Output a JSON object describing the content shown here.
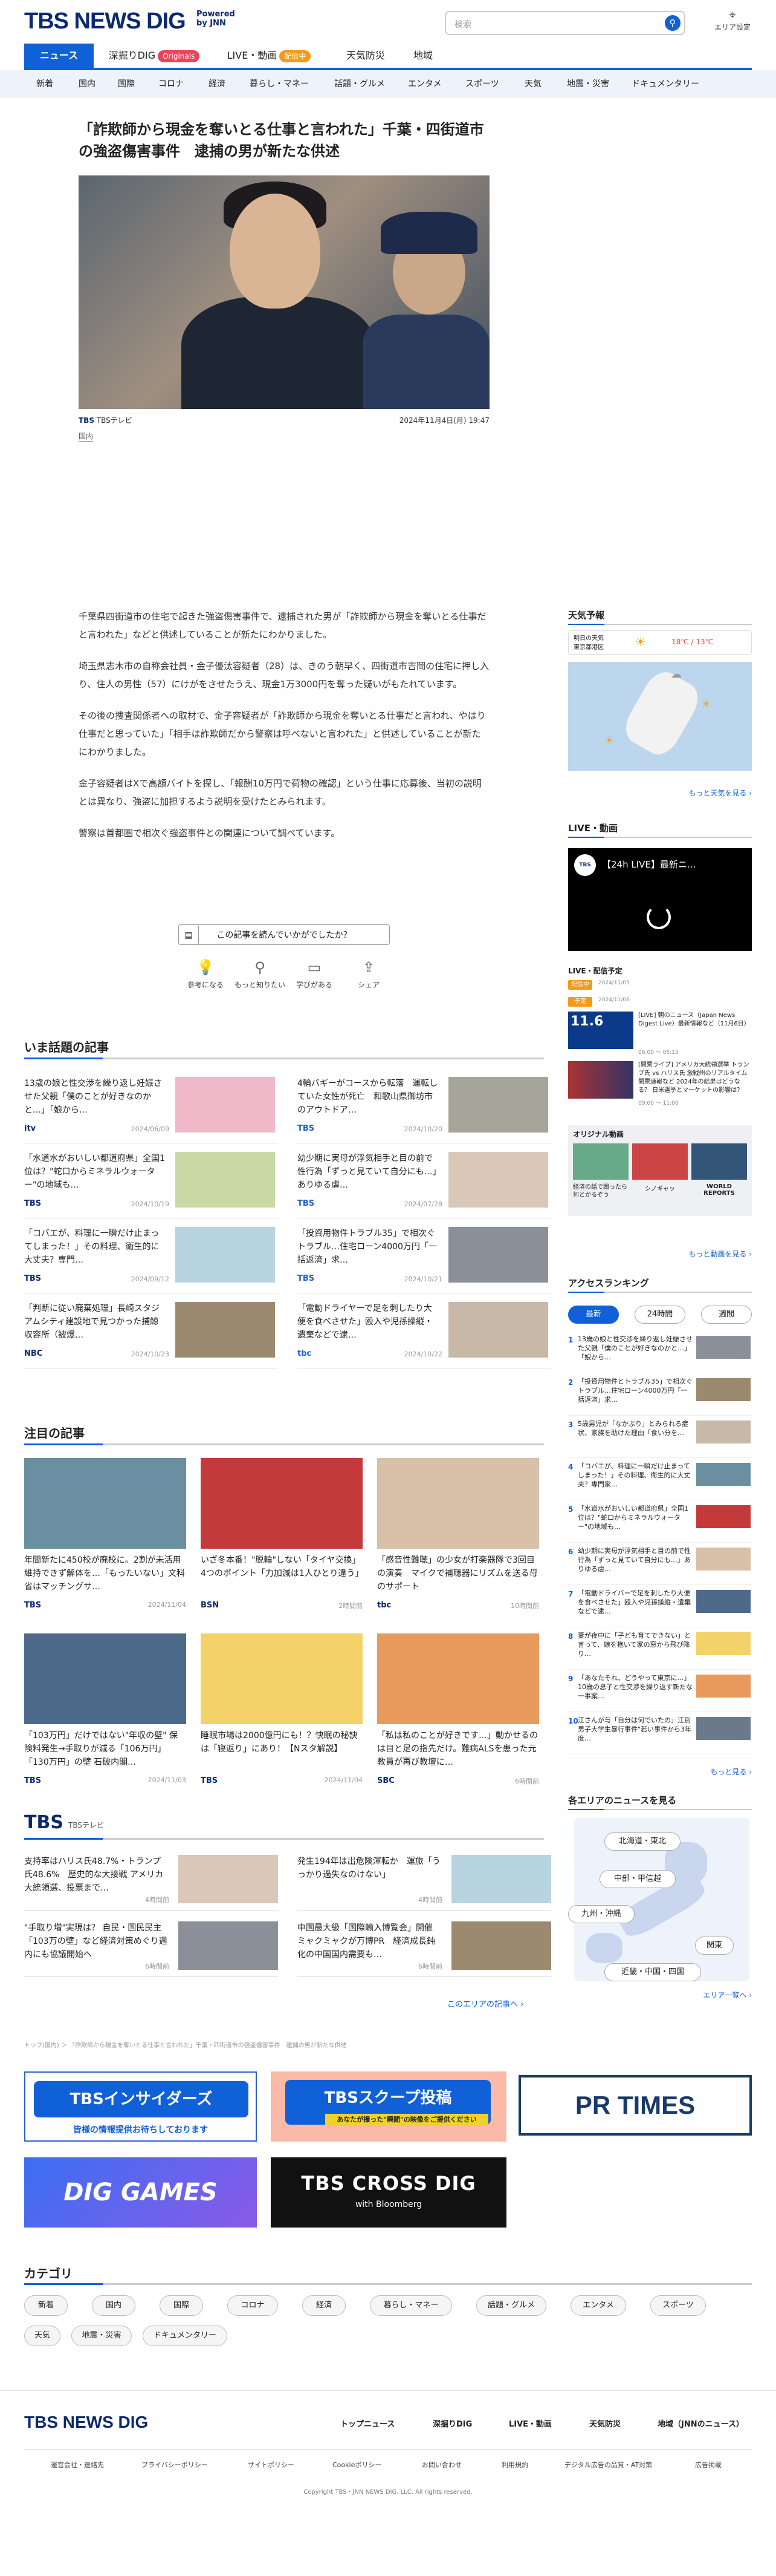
{
  "header": {
    "logo": "TBS NEWS DIG",
    "powered": "Powered by JNN",
    "search_placeholder": "検索",
    "area_label": "エリア設定"
  },
  "nav": [
    {
      "label": "ニュース"
    },
    {
      "label": "深掘りDIG",
      "tag": "Originals"
    },
    {
      "label": "LIVE・動画",
      "tag": "配信中"
    },
    {
      "label": "天気防災"
    },
    {
      "label": "地域"
    }
  ],
  "subnav": [
    "新着",
    "国内",
    "国際",
    "コロナ",
    "経済",
    "暮らし・マネー",
    "話題・グルメ",
    "エンタメ",
    "スポーツ",
    "天気",
    "地震・災害",
    "ドキュメンタリー"
  ],
  "article": {
    "title": "「詐欺師から現金を奪いとる仕事と言われた」千葉・四街道市の強盗傷害事件　逮捕の男が新たな供述",
    "source_logo": "TBS",
    "source": "TBSテレビ",
    "date": "2024年11月4日(月) 19:47",
    "category": "国内",
    "paragraphs": [
      "千葉県四街道市の住宅で起きた強盗傷害事件で、逮捕された男が「詐欺師から現金を奪いとる仕事だと言われた」などと供述していることが新たにわかりました。",
      "埼玉県志木市の自称会社員・金子優汰容疑者（28）は、きのう朝早く、四街道市吉岡の住宅に押し入り、住人の男性（57）にけがをさせたうえ、現金1万3000円を奪った疑いがもたれています。",
      "その後の捜査関係者への取材で、金子容疑者が「詐欺師から現金を奪いとる仕事だと言われ、やはり仕事だと思っていた」「相手は詐欺師だから警察は呼べないと言われた」と供述していることが新たにわかりました。",
      "金子容疑者はXで高額バイトを探し、「報酬10万円で荷物の確認」という仕事に応募後、当初の説明とは異なり、強盗に加担するよう説明を受けたとみられます。",
      "警察は首都圏で相次ぐ強盗事件との関連について調べています。"
    ],
    "reaction_prompt": "この記事を読んでいかがでしたか？",
    "reactions": [
      "参考になる",
      "もっと知りたい",
      "学びがある",
      "シェア"
    ]
  },
  "trending": {
    "title": "いま話題の記事",
    "items": [
      {
        "text": "13歳の娘と性交渉を繰り返し妊娠させた父親「僕のことが好きなのかと…」「娘から…",
        "logo": "itv",
        "date": "2024/06/09"
      },
      {
        "text": "4輪バギーがコースから転落　運転していた女性が死亡　和歌山県御坊市のアウトドア…",
        "logo": "TBS",
        "date": "2024/10/20"
      },
      {
        "text": "「水道水がおいしい都道府県」全国1位は？\"蛇口からミネラルウォーター\"の地域も…",
        "logo": "TBS",
        "date": "2024/10/19"
      },
      {
        "text": "幼少期に実母が浮気相手と目の前で性行為「ずっと見ていて自分にも…」ありゆる虐…",
        "logo": "TBS",
        "date": "2024/07/28"
      },
      {
        "text": "「コバエが、料理に一瞬だけ止まってしまった！」その料理、衛生的に大丈夫？専門…",
        "logo": "TBS",
        "date": "2024/09/12"
      },
      {
        "text": "「投資用物件トラブル35」で相次ぐトラブル…住宅ローン4000万円「一括返済」求…",
        "logo": "TBS",
        "date": "2024/10/21"
      },
      {
        "text": "「判断に従い廃棄処理」長崎スタジアムシティ建設地で見つかった捕鯨収容所（被爆…",
        "logo": "NBC",
        "date": "2024/10/23"
      },
      {
        "text": "「電動ドライヤーで足を刺したり大便を食べさせた」殴入や児孫操縦・遺棄などで逮…",
        "logo": "tbc",
        "date": "2024/10/22"
      }
    ]
  },
  "featured": {
    "title": "注目の記事",
    "items": [
      {
        "text": "年間新たに450校が廃校に。2割が未活用　維持できず解体を…「もったいない」文科省はマッチングサ…",
        "logo": "TBS",
        "date": "2024/11/04"
      },
      {
        "text": "いざ冬本番！\"脱輪\"しない「タイヤ交換」4つのポイント「力加減は1人ひとり違う」",
        "logo": "BSN",
        "date": "2時間前"
      },
      {
        "text": "「感音性難聴」の少女が打楽器隊で3回目の演奏　マイクで補聴器にリズムを送る母のサポート",
        "logo": "tbc",
        "date": "10時間前"
      },
      {
        "text": "「103万円」だけではない\"年収の壁\" 保険料発生→手取りが減る「106万円」「130万円」の壁 石破内閣…",
        "logo": "TBS",
        "date": "2024/11/03"
      },
      {
        "text": "睡眠市場は2000億円にも！？快眠の秘訣は「寝返り」にあり！【Nスタ解説】",
        "logo": "TBS",
        "date": "2024/11/04"
      },
      {
        "text": "「私は私のことが好きです…」動かせるのは目と足の指先だけ。難病ALSを患った元教員が再び教壇に…",
        "logo": "SBC",
        "date": "6時間前"
      }
    ]
  },
  "tbs": {
    "logo": "TBS",
    "label": "TBSテレビ",
    "more": "このエリアの記事へ ›",
    "items": [
      {
        "text": "支持率はハリス氏48.7%・トランプ氏48.6%　歴史的な大接戦 アメリカ大統領選、投票まで…",
        "date": "4時間前"
      },
      {
        "text": "発生194年は出危険渾転か　運旅「うっかり過失なのけない」",
        "date": "4時間前"
      },
      {
        "text": "\"手取り増\"実現は？ 自民・国民民主「103万の壁」など経済対策めぐり週内にも協議開始へ",
        "date": "6時間前"
      },
      {
        "text": "中国最大級「国際輸入博覧会」開催　ミャクミャクが万博PR　経済成長鈍化の中国国内需要も…",
        "date": "6時間前"
      }
    ]
  },
  "breadcrumb": "トップ(国内) ＞ 「詐欺師から現金を奪いとる仕事と言われた」千葉・四街道市の強盗傷害事件　逮捕の男が新たな供述",
  "banners": [
    {
      "title": "TBSインサイダーズ",
      "sub": "皆様の情報提供お待ちしております"
    },
    {
      "title": "TBSスクープ投稿",
      "sub": "あなたが撮った\"瞬間\"の映像をご提供ください"
    },
    {
      "title": "PR TIMES"
    },
    {
      "title": "DIG GAMES"
    },
    {
      "title": "TBS CROSS DIG",
      "sub": "with Bloomberg"
    }
  ],
  "categories": {
    "title": "カテゴリ",
    "items": [
      "新着",
      "国内",
      "国際",
      "コロナ",
      "経済",
      "暮らし・マネー",
      "話題・グルメ",
      "エンタメ",
      "スポーツ",
      "天気",
      "地震・災害",
      "ドキュメンタリー"
    ]
  },
  "sidebar": {
    "weather": {
      "title": "天気予報",
      "place": "明日の天気\n東京都港区",
      "temp": "18℃ / 13℃",
      "more": "もっと天気を見る ›"
    },
    "live": {
      "title": "LIVE・動画",
      "video_title": "【24h LIVE】最新ニ…",
      "schedule_title": "LIVE・配信予定",
      "items": [
        {
          "status": "配信中",
          "time": "2024/11/05",
          "text": ""
        },
        {
          "status": "予定",
          "time": "2024/11/06",
          "text": "[LIVE] 朝のニュース（Japan News Digest Live）最新情報など（11月6日）",
          "clock": "06:00 ～ 06:15"
        },
        {
          "status": "予定",
          "time": "",
          "text": "[開票ライブ] アメリカ大統領選挙 トランプ氏 vs ハリス氏 激戦州のリアルタイム開票速報など 2024年の結果はどうなる？ 日米選挙とマーケットの影響は？（11月6日午前9時〜）",
          "clock": "09:00 ～ 11:00"
        }
      ],
      "originals": {
        "title": "オリジナル動画",
        "items": [
          "経済の話で困ったら何とかるぞう",
          "シノギャッ",
          "WORLD REPORTS"
        ]
      },
      "more": "もっと動画を見る ›"
    },
    "ranking": {
      "title": "アクセスランキング",
      "tabs": [
        "最新",
        "24時間",
        "週間"
      ],
      "more": "もっと見る ›",
      "items": [
        "13歳の娘と性交渉を繰り返し妊娠させた父親「僕のことが好きなのかと…」「娘から…",
        "「投資用物件とトラブル35」で相次ぐトラブル…住宅ローン4000万円「一括返済」求…",
        "5歳男児が「なかぶり」とみられる症状、家族を助けた理由「食い分を…",
        "「コバエが、料理に一瞬だけ止まってしまった！」その料理、衛生的に大丈夫？専門家…",
        "「水道水がおいしい都道府県」全国1位は？\"蛇口からミネラルウォーター\"の地域も…",
        "幼少期に実母が浮気相手と目の前で性行為「ずっと見ていて自分にも…」ありゆる虐…",
        "「電動ドライバーで足を刺したり大便を食べさせた」殴入や児孫操縦・遺棄などで逮…",
        "妻が夜中に「子ども育てできない」と言って、娘を抱いて家の窓から飛び降り…",
        "「あなたそれ、どうやって東京に…」10歳の息子と性交渉を繰り返す新たな一事案…",
        "江さんが与「自分は何でいたの」江別男子大学生暴行事件\"若い事件から3年度…"
      ]
    },
    "area": {
      "title": "各エリアのニュースを見る",
      "pills": [
        "北海道・東北",
        "中部・甲信越",
        "九州・沖縄",
        "関東",
        "近畿・中国・四国"
      ],
      "more": "エリア一覧へ ›"
    }
  },
  "footer": {
    "logo": "TBS NEWS DIG",
    "links": [
      "トップニュース",
      "深掘りDIG",
      "LIVE・動画",
      "天気防災",
      "地域（JNNのニュース）"
    ],
    "small": [
      "運営会社・連絡先",
      "プライバシーポリシー",
      "サイトポリシー",
      "Cookieポリシー",
      "お問い合わせ",
      "利用規約",
      "デジタル広告の品質・AT対策",
      "広告掲載"
    ],
    "copyright": "Copyright TBS・JNN NEWS DIG, LLC. All rights reserved."
  }
}
